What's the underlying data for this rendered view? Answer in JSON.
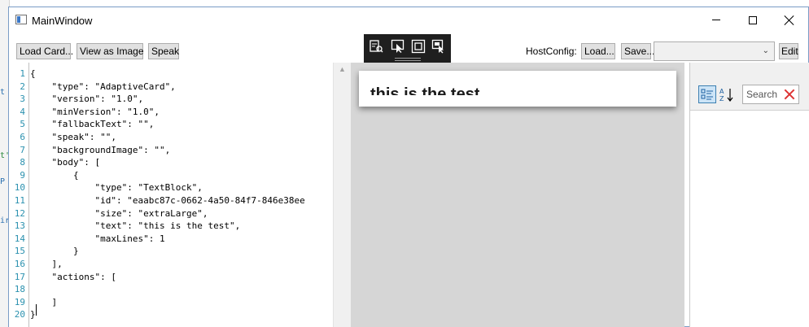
{
  "window": {
    "title": "MainWindow"
  },
  "toolbar": {
    "load_card": "Load Card...",
    "view_as_image": "View as Image",
    "speak": "Speak",
    "hostconfig_label": "HostConfig:",
    "hostconfig_load": "Load...",
    "hostconfig_save": "Save...",
    "hostconfig_selected": "",
    "edit": "Edit"
  },
  "editor": {
    "lines": [
      {
        "n": "1",
        "text": "{"
      },
      {
        "n": "2",
        "text": "    \"type\": \"AdaptiveCard\","
      },
      {
        "n": "3",
        "text": "    \"version\": \"1.0\","
      },
      {
        "n": "4",
        "text": "    \"minVersion\": \"1.0\","
      },
      {
        "n": "5",
        "text": "    \"fallbackText\": \"\","
      },
      {
        "n": "6",
        "text": "    \"speak\": \"\","
      },
      {
        "n": "7",
        "text": "    \"backgroundImage\": \"\","
      },
      {
        "n": "8",
        "text": "    \"body\": ["
      },
      {
        "n": "9",
        "text": "        {"
      },
      {
        "n": "10",
        "text": "            \"type\": \"TextBlock\","
      },
      {
        "n": "11",
        "text": "            \"id\": \"eaabc87c-0662-4a50-84f7-846e38ee"
      },
      {
        "n": "12",
        "text": "            \"size\": \"extraLarge\","
      },
      {
        "n": "13",
        "text": "            \"text\": \"this is the test\","
      },
      {
        "n": "14",
        "text": "            \"maxLines\": 1"
      },
      {
        "n": "15",
        "text": "        }"
      },
      {
        "n": "16",
        "text": "    ],"
      },
      {
        "n": "17",
        "text": "    \"actions\": ["
      },
      {
        "n": "18",
        "text": ""
      },
      {
        "n": "19",
        "text": "    ]"
      },
      {
        "n": "20",
        "text": "}"
      }
    ]
  },
  "preview": {
    "card_text": "this is the test"
  },
  "properties": {
    "search_placeholder": "Search"
  },
  "background": {
    "fragments": [
      "t",
      "t'",
      "P",
      "ir"
    ]
  },
  "colors": {
    "line_numbers": "#2b91af",
    "preview_bg": "#d6d6d6",
    "devbar_bg": "#1f1f1f",
    "clear_icon": "#dd3333"
  }
}
